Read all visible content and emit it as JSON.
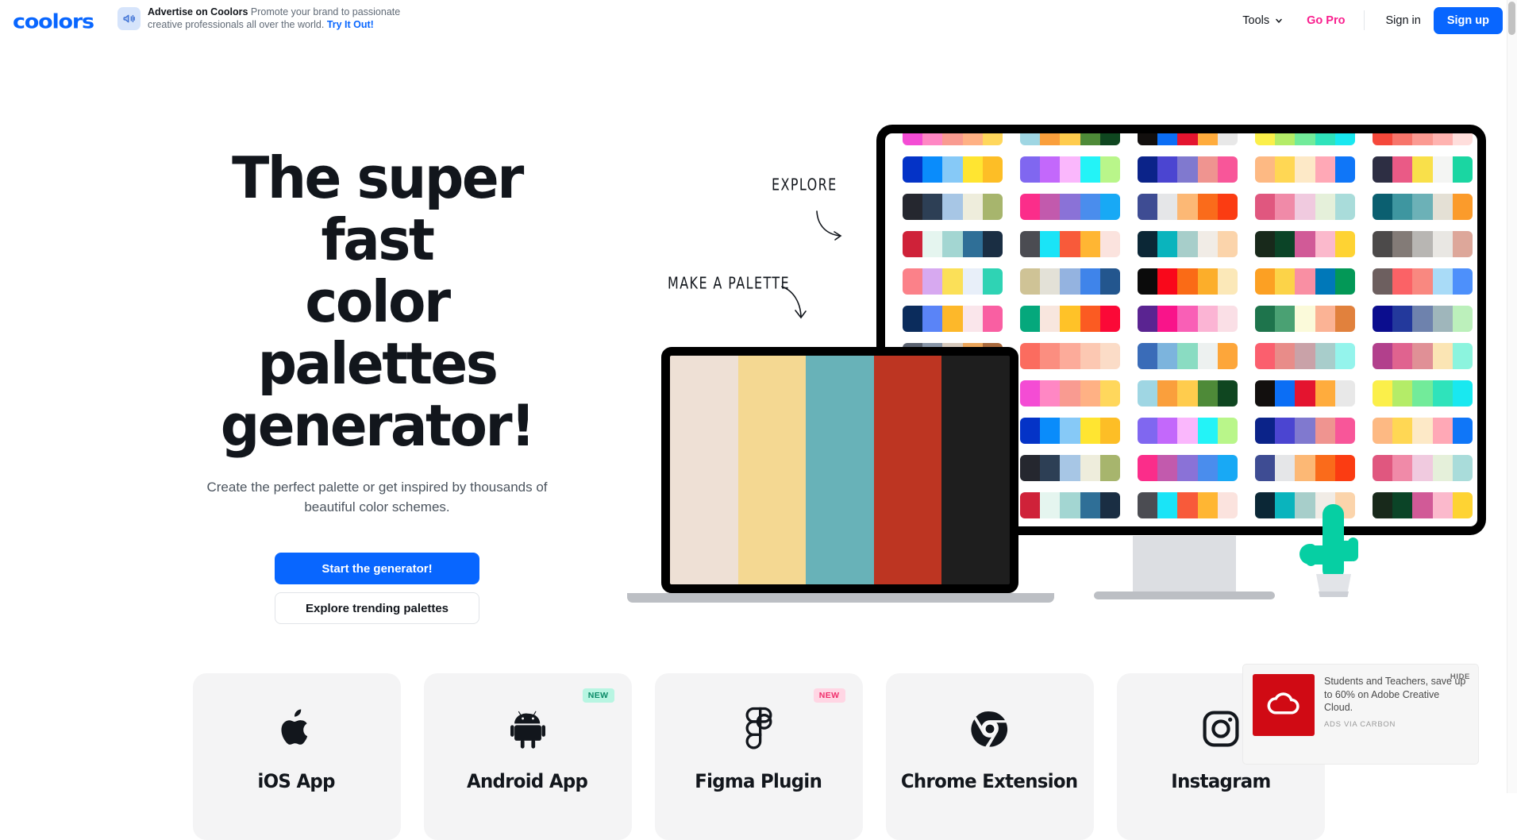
{
  "brand": {
    "logo_text": "coolors",
    "accent": "#0866ff",
    "pink": "#f91f8e"
  },
  "header": {
    "promo": {
      "icon": "megaphone-icon",
      "strong": "Advertise on Coolors",
      "body": "Promote your brand to passionate creative professionals all over the world.",
      "link": "Try It Out!"
    },
    "nav": {
      "tools": "Tools",
      "tools_chevron": "chevron-down-icon",
      "go_pro": "Go Pro",
      "sign_in": "Sign in",
      "sign_up": "Sign up"
    }
  },
  "hero": {
    "title_line1": "The super fast",
    "title_line2": "color palettes",
    "title_line3": "generator!",
    "subtitle": "Create the perfect palette or get inspired by thousands of beautiful color schemes.",
    "primary_button": "Start the generator!",
    "secondary_button": "Explore trending palettes"
  },
  "annotations": {
    "explore": "EXPLORE",
    "make_a_palette": "MAKE A PALETTE"
  },
  "devices": {
    "laptop_palette": [
      "#eee0d5",
      "#f4d892",
      "#68b2b8",
      "#bd3522",
      "#1e1e1e"
    ],
    "cactus_color": "#06cfa3",
    "cactus_pot_color": "#e2e4e8",
    "monitor_palettes": [
      [
        "#f44cd4",
        "#ff87c4",
        "#f99b91",
        "#ffb184",
        "#ffd75c"
      ],
      [
        "#9fd6e3",
        "#fa9f3c",
        "#ffcc4d",
        "#4e8a38",
        "#0f4620"
      ],
      [
        "#120f0e",
        "#0b6ef5",
        "#e4142f",
        "#ffac3d",
        "#e8e8e8"
      ],
      [
        "#fbef4a",
        "#b4ec68",
        "#72eb9a",
        "#2fe3bb",
        "#19e8f0"
      ],
      [
        "#f5483b",
        "#f7756b",
        "#fb9a92",
        "#ffb3b0",
        "#ffdedc"
      ],
      [
        "#6f5d14",
        "#a9b089",
        "#fdd6c4",
        "#ff7a19",
        "#f7511f"
      ],
      [
        "#0433c7",
        "#0a8cfb",
        "#86c9f7",
        "#ffe531",
        "#fdbe26"
      ],
      [
        "#8067f0",
        "#c368fb",
        "#fab7fc",
        "#23f3f7",
        "#b9f68a"
      ],
      [
        "#0b2389",
        "#4b45d1",
        "#8079cf",
        "#ef9490",
        "#f85699"
      ],
      [
        "#fdb983",
        "#ffd754",
        "#fde9c7",
        "#ffa8b6",
        "#0f76f8"
      ],
      [
        "#2d2e43",
        "#ea5a86",
        "#f9e04a",
        "#f4f5f3",
        "#1ad6a2"
      ],
      [
        "#5c3e34",
        "#c59a7f",
        "#f9cba6",
        "#f6eff7",
        "#aa9ddf"
      ],
      [
        "#25272f",
        "#2d3f55",
        "#a7c6e5",
        "#eeeddc",
        "#a7b56d"
      ],
      [
        "#fb2d8a",
        "#c25aad",
        "#8a72d7",
        "#4a8ded",
        "#18a9f5"
      ],
      [
        "#3e4c93",
        "#e5e6e8",
        "#fcb875",
        "#fa6b1b",
        "#fb3c12"
      ],
      [
        "#e0577f",
        "#f08aa8",
        "#f0cadf",
        "#e5f0da",
        "#a9dcda"
      ],
      [
        "#0b5f70",
        "#3e96a0",
        "#6cb1b7",
        "#e4e0d5",
        "#fb9b2b"
      ],
      [
        "#4a9de0",
        "#7dc7f8",
        "#f2f3f5",
        "#ffd94c",
        "#fa4a72"
      ],
      [
        "#cf2239",
        "#e5f5ef",
        "#a3d6d2",
        "#2f6f97",
        "#1a2e43"
      ],
      [
        "#4b4c52",
        "#1ae4f7",
        "#f85a3a",
        "#ffb633",
        "#fbe3de"
      ],
      [
        "#0b2736",
        "#0ab4bd",
        "#a7ceca",
        "#f1ece6",
        "#fbd4ab"
      ],
      [
        "#18291b",
        "#0b4427",
        "#d15a97",
        "#fbb9cc",
        "#fed333"
      ],
      [
        "#4c4a4a",
        "#837b77",
        "#b8b6b3",
        "#e9e7e3",
        "#dda79a"
      ],
      [
        "#0e5b75",
        "#16a497",
        "#43c293",
        "#75e8a2",
        "#b6f5c5"
      ],
      [
        "#fb8189",
        "#d7a9f0",
        "#fbe058",
        "#e8eff9",
        "#2fd3b4"
      ],
      [
        "#cfc396",
        "#e3e1d7",
        "#94b3e0",
        "#3f84ea",
        "#23568e"
      ],
      [
        "#0b0b0b",
        "#f9081b",
        "#fa6b16",
        "#fcae2a",
        "#fbe8b8"
      ],
      [
        "#fca023",
        "#fcd348",
        "#f98fa3",
        "#0078b9",
        "#039857"
      ],
      [
        "#6d5f5f",
        "#fb6266",
        "#f98880",
        "#a9dbf7",
        "#4d90fb"
      ],
      [
        "#09063a",
        "#0b7fba",
        "#1fd9a1",
        "#f6dcbe",
        "#f0797b"
      ],
      [
        "#0b2c5c",
        "#5a84f7",
        "#fdb82a",
        "#fae6eb",
        "#f95fa2"
      ],
      [
        "#05a87c",
        "#f8e6de",
        "#ffc228",
        "#fb5b22",
        "#fb0937"
      ],
      [
        "#5a2491",
        "#f9148a",
        "#f95fb6",
        "#fbb4d4",
        "#fadfe6"
      ],
      [
        "#1e744c",
        "#4aa173",
        "#fbfada",
        "#fbb395",
        "#e1813d"
      ],
      [
        "#0b0d8e",
        "#23399c",
        "#6e82ad",
        "#9fb6bb",
        "#bcf0bb"
      ],
      [
        "#5c5a82",
        "#a494b8",
        "#b2c2d5",
        "#d5f3ec",
        "#d7c699"
      ],
      [
        "#5a6270",
        "#8795a7",
        "#d6c9bc",
        "#eba55a",
        "#a9693c"
      ],
      [
        "#fb6c5f",
        "#fb8e80",
        "#fcab9a",
        "#fcc8b2",
        "#fbdcc7"
      ],
      [
        "#3a6cb8",
        "#7cb4dd",
        "#8adcc2",
        "#edf1f0",
        "#fda63a"
      ],
      [
        "#fb5f6e",
        "#e88c89",
        "#c9a2a8",
        "#a8cdcb",
        "#94f4ec"
      ],
      [
        "#b2408c",
        "#e0638f",
        "#e09096",
        "#fbe5b4",
        "#8cf4de"
      ],
      [
        "#8f86fb",
        "#b7b6fb",
        "#f6f7fa",
        "#fdeadc",
        "#fcd7c3"
      ],
      [
        "#1e1e1e",
        "#bd3522",
        "#68b2b8",
        "#f4d892",
        "#eee0d5"
      ]
    ]
  },
  "cards": [
    {
      "label": "iOS App",
      "icon": "apple-icon",
      "badge": null
    },
    {
      "label": "Android App",
      "icon": "android-icon",
      "badge": "NEW",
      "badge_style": "green"
    },
    {
      "label": "Figma Plugin",
      "icon": "figma-icon",
      "badge": "NEW",
      "badge_style": "pink"
    },
    {
      "label": "Chrome Extension",
      "icon": "chrome-icon",
      "badge": null
    },
    {
      "label": "Instagram",
      "icon": "instagram-icon",
      "badge": null
    }
  ],
  "ad": {
    "hide_label": "HIDE",
    "text": "Students and Teachers, save up to 60% on Adobe Creative Cloud.",
    "via": "ADS VIA CARBON",
    "image_icon": "adobe-creative-cloud-icon",
    "image_color": "#d00a14"
  }
}
